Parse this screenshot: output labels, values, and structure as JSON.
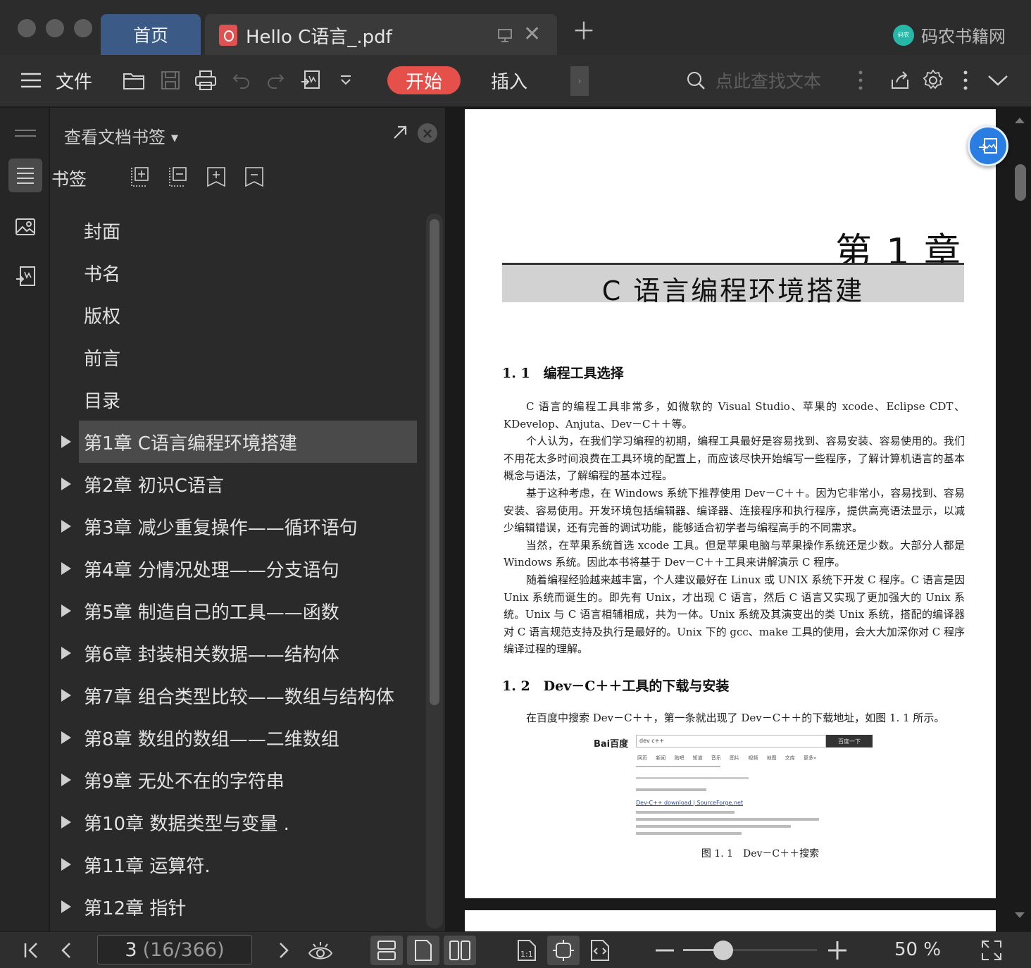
{
  "window": {
    "tabs": [
      {
        "label": "首页",
        "active": false
      },
      {
        "label": "Hello C语言_.pdf",
        "active": true
      }
    ],
    "brand": {
      "logo_text": "码农",
      "name": "码农书籍网"
    }
  },
  "toolbar": {
    "menu_label": "文件",
    "tabs": [
      {
        "label": "开始",
        "active": true
      },
      {
        "label": "插入",
        "active": false
      }
    ],
    "search_placeholder": "点此查找文本",
    "colors": {
      "accent": "#e5504a"
    }
  },
  "bookmarks": {
    "header": "查看文档书签",
    "section_label": "书签",
    "items": [
      {
        "label": "封面",
        "expandable": false
      },
      {
        "label": "书名",
        "expandable": false
      },
      {
        "label": "版权",
        "expandable": false
      },
      {
        "label": "前言",
        "expandable": false
      },
      {
        "label": "目录",
        "expandable": false
      },
      {
        "label": "第1章 C语言编程环境搭建",
        "expandable": true,
        "selected": true
      },
      {
        "label": "第2章 初识C语言",
        "expandable": true
      },
      {
        "label": "第3章 减少重复操作——循环语句",
        "expandable": true
      },
      {
        "label": "第4章 分情况处理——分支语句",
        "expandable": true
      },
      {
        "label": "第5章 制造自己的工具——函数",
        "expandable": true
      },
      {
        "label": "第6章 封装相关数据——结构体",
        "expandable": true
      },
      {
        "label": "第7章 组合类型比较——数组与结构体",
        "expandable": true
      },
      {
        "label": "第8章 数组的数组——二维数组",
        "expandable": true
      },
      {
        "label": "第9章 无处不在的字符串",
        "expandable": true
      },
      {
        "label": "第10章 数据类型与变量 .",
        "expandable": true
      },
      {
        "label": "第11章 运算符.",
        "expandable": true
      },
      {
        "label": "第12章 指针",
        "expandable": true
      }
    ]
  },
  "document": {
    "chapter_title": "第 1 章",
    "chapter_subtitle": "C 语言编程环境搭建",
    "sec1_title": "1. 1　编程工具选择",
    "sec1_paras": [
      "C 语言的编程工具非常多，如微软的 Visual Studio、苹果的 xcode、Eclipse CDT、KDevelop、Anjuta、Dev－C＋＋等。",
      "个人认为，在我们学习编程的初期，编程工具最好是容易找到、容易安装、容易使用的。我们不用花太多时间浪费在工具环境的配置上，而应该尽快开始编写一些程序，了解计算机语言的基本概念与语法，了解编程的基本过程。",
      "基于这种考虑，在 Windows 系统下推荐使用 Dev－C＋＋。因为它非常小，容易找到、容易安装、容易使用。开发环境包括编辑器、编译器、连接程序和执行程序，提供高亮语法显示，以减少编辑错误，还有完善的调试功能，能够适合初学者与编程高手的不同需求。",
      "当然，在苹果系统首选 xcode 工具。但是苹果电脑与苹果操作系统还是少数。大部分人都是 Windows 系统。因此本书将基于 Dev－C＋＋工具来讲解演示 C 程序。",
      "随着编程经验越来越丰富，个人建议最好在 Linux 或 UNIX 系统下开发 C 程序。C 语言是因 Unix 系统而诞生的。即先有 Unix，才出现 C 语言，然后 C 语言又实现了更加强大的 Unix 系统。Unix 与 C 语言相辅相成，共为一体。Unix 系统及其演变出的类 Unix 系统，搭配的编译器对 C 语言规范支持及执行是最好的。Unix 下的 gcc、make 工具的使用，会大大加深你对 C 程序编译过程的理解。"
    ],
    "sec2_title": "1. 2　Dev－C＋＋工具的下载与安装",
    "sec2_para": "在百度中搜索 Dev－C＋＋，第一条就出现了 Dev－C＋＋的下载地址，如图 1. 1 所示。",
    "figure": {
      "logo": "Bai百度",
      "query": "dev c++",
      "button": "百度一下",
      "nav": "网页 新闻 贴吧 知道 音乐 图片 视频 地图 文库 更多»",
      "result_title": "Dev-C++ download | SourceForge.net",
      "caption": "图 1. 1　Dev－C＋＋搜索"
    }
  },
  "statusbar": {
    "page_current": "3",
    "page_detail": "(16/366)",
    "zoom_level": "50 %",
    "zoom_fraction": 0.3
  }
}
